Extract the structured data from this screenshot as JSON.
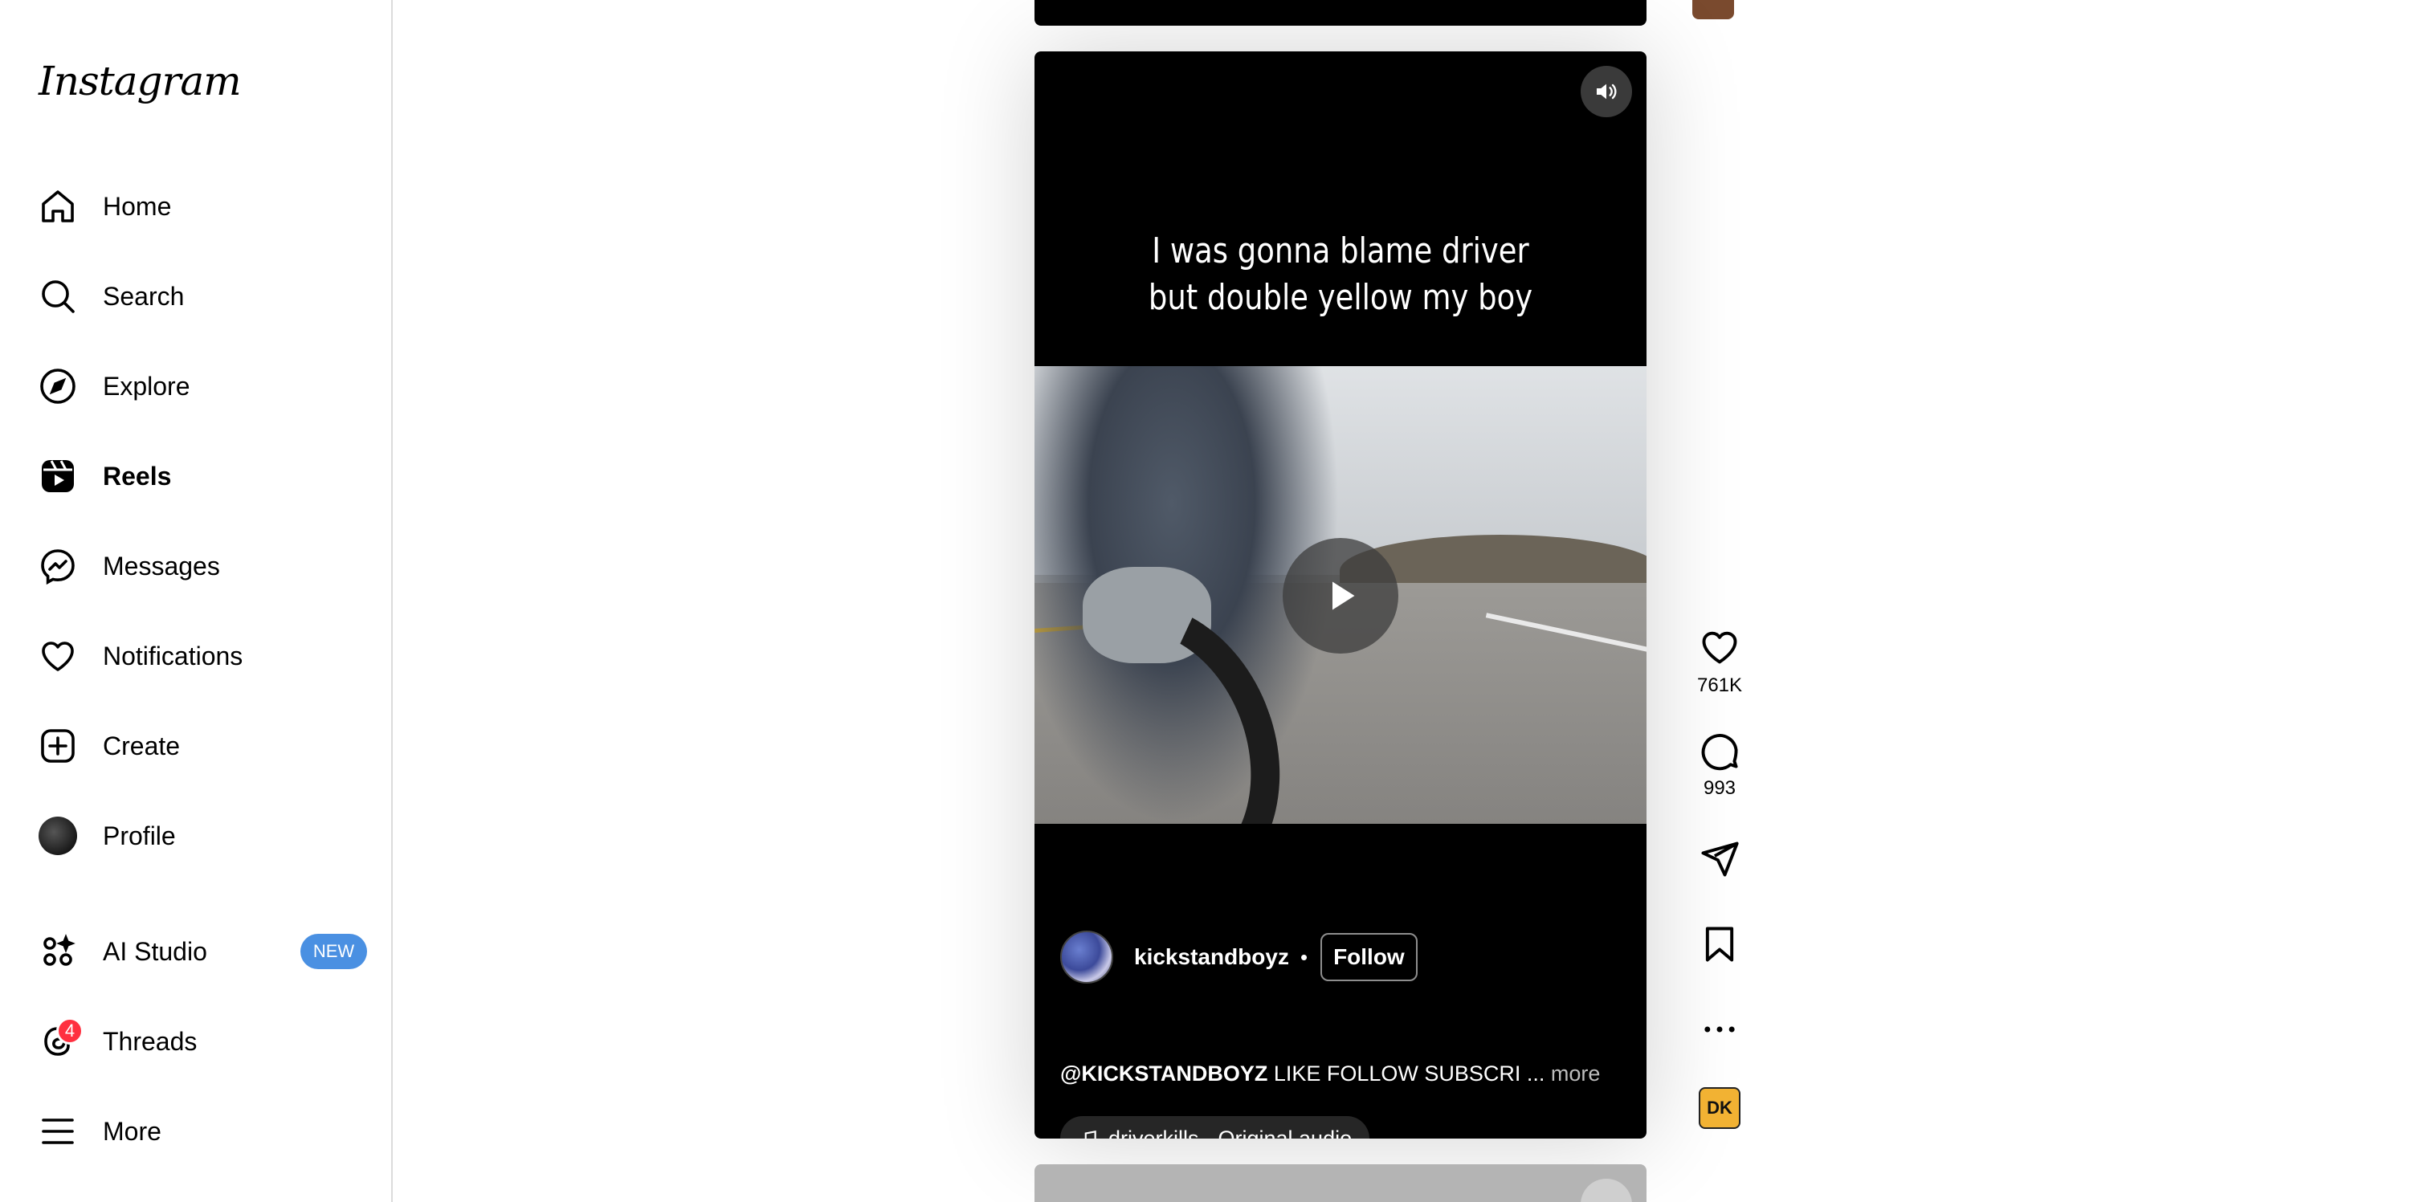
{
  "app": {
    "logo": "Instagram"
  },
  "sidebar": {
    "items": [
      {
        "label": "Home",
        "icon": "home-icon"
      },
      {
        "label": "Search",
        "icon": "search-icon"
      },
      {
        "label": "Explore",
        "icon": "explore-icon"
      },
      {
        "label": "Reels",
        "icon": "reels-icon",
        "active": true
      },
      {
        "label": "Messages",
        "icon": "messages-icon"
      },
      {
        "label": "Notifications",
        "icon": "heart-icon"
      },
      {
        "label": "Create",
        "icon": "create-icon"
      },
      {
        "label": "Profile",
        "icon": "avatar"
      }
    ],
    "ai_studio": {
      "label": "AI Studio",
      "badge": "NEW",
      "icon": "ai-studio-icon"
    },
    "threads": {
      "label": "Threads",
      "badge_count": "4",
      "icon": "threads-icon"
    },
    "more": {
      "label": "More",
      "icon": "menu-icon"
    }
  },
  "reel": {
    "overlay_caption": "I was gonna blame driver but double yellow my boy",
    "author": "kickstandboyz",
    "separator": "•",
    "follow_label": "Follow",
    "description_handle": "@KICKSTANDBOYZ",
    "description_text": " LIKE FOLLOW SUBSCRI ...",
    "description_more": " more",
    "audio": "driverkills · Original audio"
  },
  "actions": {
    "likes": "761K",
    "comments": "993",
    "dk_logo": "DK"
  },
  "colors": {
    "accent_blue": "#4a90e2",
    "notification_red": "#ff3040",
    "dk_gold": "#f2b233"
  }
}
